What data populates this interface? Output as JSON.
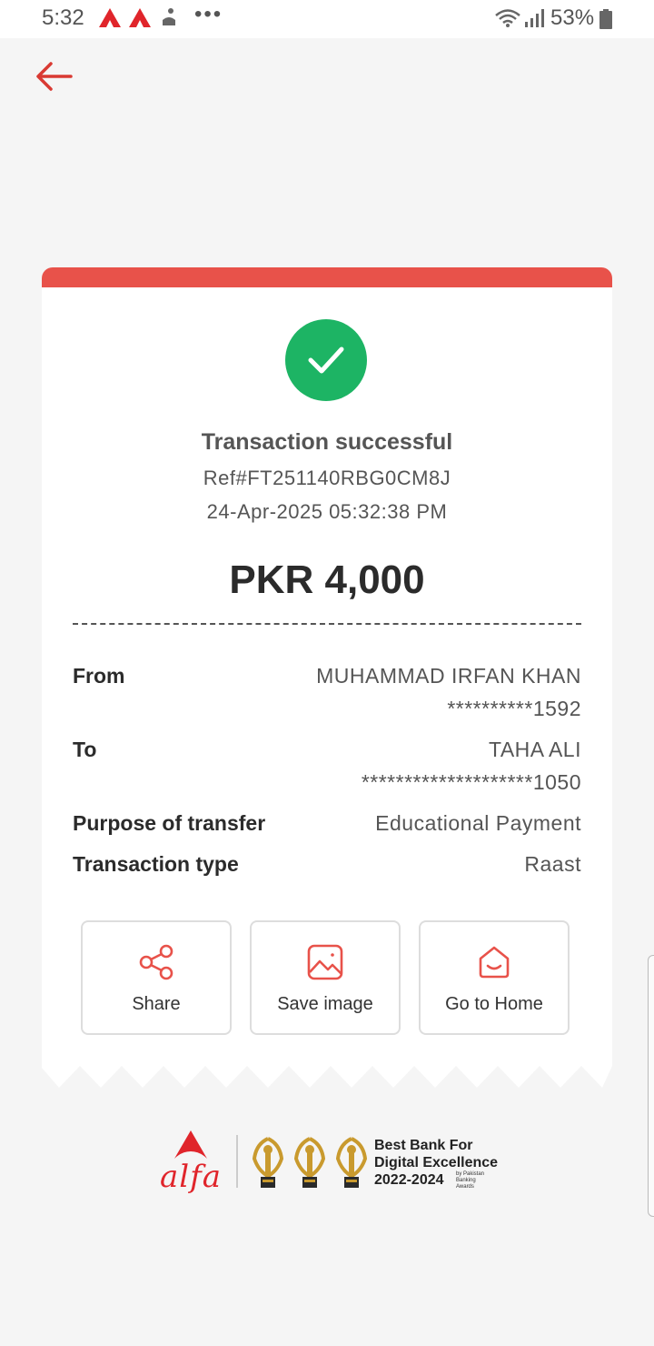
{
  "status_bar": {
    "time": "5:32",
    "dots": "•••",
    "battery_percent": "53%"
  },
  "colors": {
    "accent": "#e8524a",
    "success": "#1db464",
    "brand": "#e0252b"
  },
  "receipt": {
    "title": "Transaction successful",
    "reference": "Ref#FT251140RBG0CM8J",
    "datetime": "24-Apr-2025 05:32:38 PM",
    "amount": "PKR 4,000",
    "details": {
      "from_label": "From",
      "from_name": "MUHAMMAD IRFAN KHAN",
      "from_account": "**********1592",
      "to_label": "To",
      "to_name": "TAHA ALI",
      "to_account": "********************1050",
      "purpose_label": "Purpose of transfer",
      "purpose_value": "Educational Payment",
      "type_label": "Transaction type",
      "type_value": "Raast"
    },
    "actions": {
      "share": "Share",
      "save_image": "Save image",
      "go_home": "Go to Home"
    }
  },
  "footer": {
    "brand": "alfa",
    "award_line1": "Best Bank For",
    "award_line2": "Digital Excellence",
    "award_years": "2022-2024",
    "award_by": "by Pakistan Banking Awards"
  }
}
